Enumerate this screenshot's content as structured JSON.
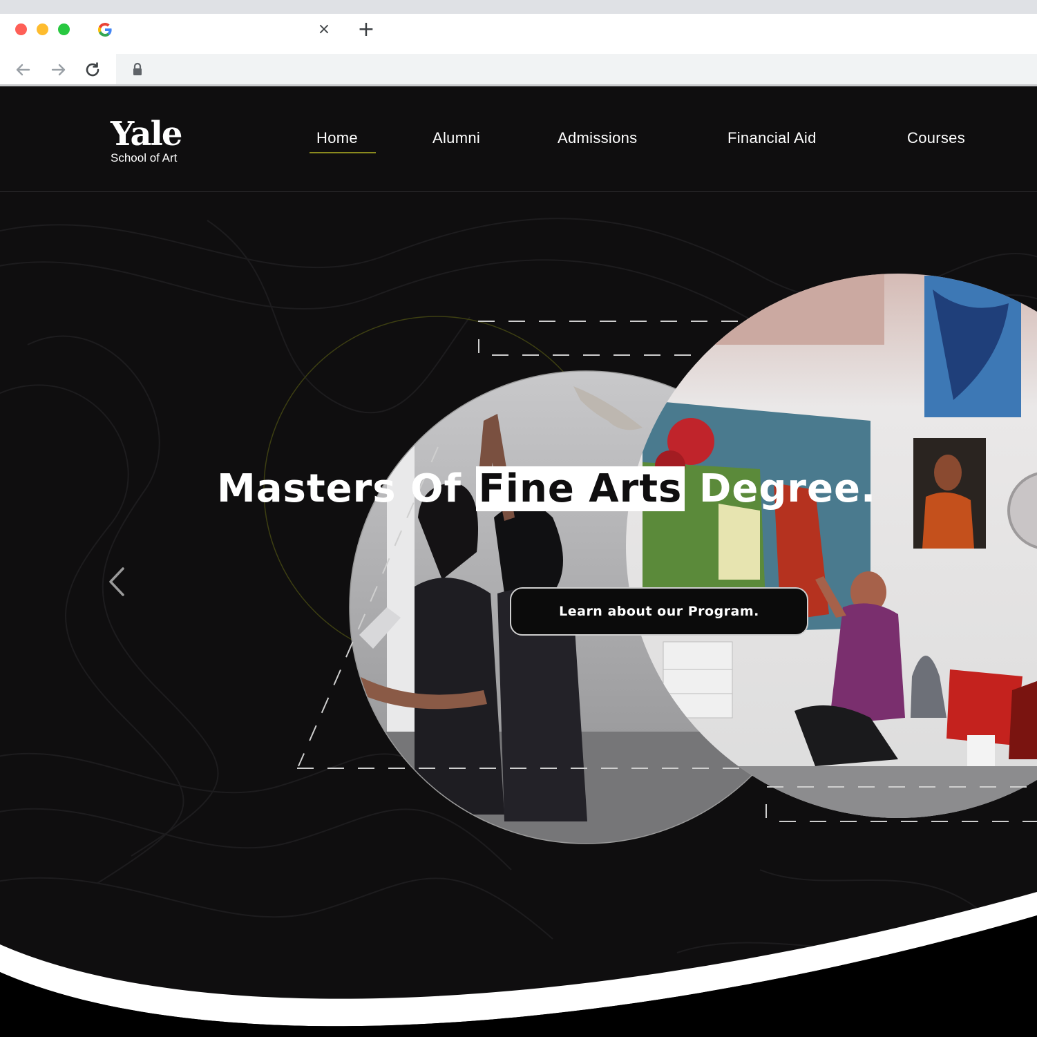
{
  "browser": {
    "tab_close_icon": "close-icon",
    "tab_new_icon": "plus-icon",
    "close_glyph": "×",
    "new_glyph": "+"
  },
  "site": {
    "logo": {
      "main": "Yale",
      "sub": "School of Art"
    },
    "nav": [
      {
        "label": "Home",
        "active": true
      },
      {
        "label": "Alumni"
      },
      {
        "label": "Admissions"
      },
      {
        "label": "Financial Aid"
      },
      {
        "label": "Courses"
      }
    ],
    "accent_color": "#8a8a1e"
  },
  "hero": {
    "title_part1": "Masters Of",
    "title_highlight": "Fine Arts",
    "title_part2": "Degree.",
    "cta_label": "Learn about our Program.",
    "prev_icon": "chevron-left-icon"
  }
}
